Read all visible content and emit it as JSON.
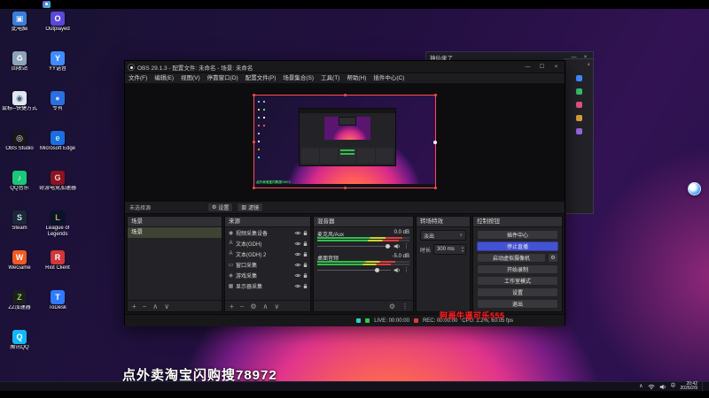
{
  "colors": {
    "accent_button": "#4452d4",
    "live_dot": "#2ecc40",
    "rec_dot": "#de3c3c",
    "health_teal": "#2fd0c8",
    "selection_red": "#ff4d4d",
    "watermark_red": "#ff2020",
    "nested_green": "#35d94e"
  },
  "desktop": {
    "icons_col1": [
      {
        "label": "此电脑",
        "glyph": "▣",
        "bg": "#3b7dd8",
        "fg": "#eaf2ff",
        "name": "this-pc-icon"
      },
      {
        "label": "回收站",
        "glyph": "♻",
        "bg": "#8fa3b8",
        "fg": "#ffffff",
        "name": "recycle-bin-icon"
      },
      {
        "label": "鼠标--快捷方式",
        "glyph": "◉",
        "bg": "#dfe7f2",
        "fg": "#4a5a75",
        "name": "mouse-shortcut-icon"
      },
      {
        "label": "OBS Studio",
        "glyph": "◎",
        "bg": "#17171a",
        "fg": "#ffffff",
        "name": "obs-studio-icon"
      },
      {
        "label": "QQ音乐",
        "glyph": "♪",
        "bg": "#19c87a",
        "fg": "#ffffff",
        "name": "qq-music-icon"
      },
      {
        "label": "Steam",
        "glyph": "S",
        "bg": "#1b2838",
        "fg": "#cfe3f5",
        "name": "steam-icon"
      },
      {
        "label": "WeGame",
        "glyph": "W",
        "bg": "#f05a23",
        "fg": "#ffffff",
        "name": "wegame-icon"
      },
      {
        "label": "ZZ加速器",
        "glyph": "Z",
        "bg": "#1d1d22",
        "fg": "#8be04a",
        "name": "zz-accelerator-icon"
      },
      {
        "label": "腾讯QQ",
        "glyph": "Q",
        "bg": "#12b7f5",
        "fg": "#ffffff",
        "name": "qq-icon"
      }
    ],
    "icons_col2": [
      {
        "label": "Outplayed",
        "glyph": "O",
        "bg": "#5a48d8",
        "fg": "#ffffff",
        "name": "outplayed-icon"
      },
      {
        "label": "YY语音",
        "glyph": "Y",
        "bg": "#3f8cff",
        "fg": "#ffffff",
        "name": "yy-icon"
      },
      {
        "label": "专有",
        "glyph": "●",
        "bg": "#2b6fe0",
        "fg": "#bfe0ff",
        "name": "blue-app-icon"
      },
      {
        "label": "Microsoft Edge",
        "glyph": "e",
        "bg": "#1a6ee0",
        "fg": "#aef0e8",
        "name": "edge-icon"
      },
      {
        "label": "奇游电竞加速器",
        "glyph": "G",
        "bg": "#8a1420",
        "fg": "#ffd0d0",
        "name": "qiyou-accelerator-icon"
      },
      {
        "label": "League of Legends",
        "glyph": "L",
        "bg": "#0a1428",
        "fg": "#c8aa6e",
        "name": "lol-icon"
      },
      {
        "label": "Riot Client",
        "glyph": "R",
        "bg": "#d13639",
        "fg": "#ffffff",
        "name": "riot-client-icon"
      },
      {
        "label": "ToDesk",
        "glyph": "T",
        "bg": "#2f7bff",
        "fg": "#ffffff",
        "name": "todesk-icon"
      }
    ],
    "watermark_white": "点外卖淘宝闪购搜78972",
    "watermark_red": "阿哥牛逼可乐555",
    "background_window_title": "神仙来了"
  },
  "obs": {
    "title": "OBS 29.1.3 - 配置文件: 未命名 - 场景: 未命名",
    "menu": [
      "文件(F)",
      "编辑(E)",
      "视图(V)",
      "停靠窗口(D)",
      "配置文件(P)",
      "场景集合(S)",
      "工具(T)",
      "帮助(H)",
      "插件中心(C)"
    ],
    "preview": {
      "watermark": "点外卖淘宝闪购搜78972"
    },
    "source_toolbar": {
      "no_source": "未选择源",
      "settings": "设置",
      "filters": "滤镜"
    },
    "docks": {
      "scenes": {
        "title": "场景",
        "items": [
          {
            "label": "场景",
            "class": "selected"
          }
        ],
        "toolbar": [
          {
            "glyph": "+",
            "name": "add-scene-icon"
          },
          {
            "glyph": "−",
            "name": "remove-scene-icon"
          },
          {
            "glyph": "∧",
            "name": "scene-up-icon"
          },
          {
            "glyph": "∨",
            "name": "scene-down-icon"
          }
        ]
      },
      "sources": {
        "title": "来源",
        "items": [
          {
            "label": "视频采集设备",
            "glyph": "◉",
            "icon": "video-capture-icon"
          },
          {
            "label": "文本(GDH)",
            "glyph": "A",
            "icon": "text-source-icon"
          },
          {
            "label": "文本(GDH) 2",
            "glyph": "A",
            "icon": "text-source-icon"
          },
          {
            "label": "窗口采集",
            "glyph": "▭",
            "icon": "window-capture-icon"
          },
          {
            "label": "游戏采集",
            "glyph": "◈",
            "icon": "game-capture-icon"
          },
          {
            "label": "显示器采集",
            "glyph": "▦",
            "icon": "display-capture-icon"
          }
        ],
        "toolbar": [
          {
            "glyph": "+",
            "name": "add-source-icon"
          },
          {
            "glyph": "−",
            "name": "remove-source-icon"
          },
          {
            "glyph": "⚙",
            "name": "source-properties-icon"
          },
          {
            "glyph": "∧",
            "name": "source-up-icon"
          },
          {
            "glyph": "∨",
            "name": "source-down-icon"
          }
        ]
      },
      "mixer": {
        "title": "混音器",
        "channels": [
          {
            "label": "麦克风/Aux",
            "db": "0.0 dB",
            "meter_l": 92,
            "meter_r": 88,
            "knob": 96
          },
          {
            "label": "桌面音频",
            "db": "-5.0 dB",
            "meter_l": 85,
            "meter_r": 80,
            "knob": 82
          }
        ],
        "toolbar": [
          {
            "glyph": "⚙",
            "name": "mixer-settings-icon"
          },
          {
            "glyph": "⋮",
            "name": "mixer-options-icon"
          }
        ]
      },
      "transitions": {
        "title": "转场特效",
        "selected": "淡出",
        "duration_label": "时长",
        "duration_value": "300 ms"
      },
      "controls": {
        "title": "控制按钮",
        "buttons": [
          {
            "label": "插件中心"
          },
          {
            "label": "停止直播",
            "class": "accent"
          },
          {
            "label": "启动虚拟摄像机",
            "gear": true
          },
          {
            "label": "开始录制"
          },
          {
            "label": "工作室模式"
          },
          {
            "label": "设置"
          },
          {
            "label": "退出"
          }
        ]
      }
    },
    "status": {
      "live": "LIVE: 00:00:00",
      "rec": "REC: 00:00:00",
      "stats": "CPU: 1.2%, 60.05 fps"
    }
  },
  "taskbar": {
    "lang": "中",
    "time": "20:42",
    "date": "2026/2/9"
  }
}
